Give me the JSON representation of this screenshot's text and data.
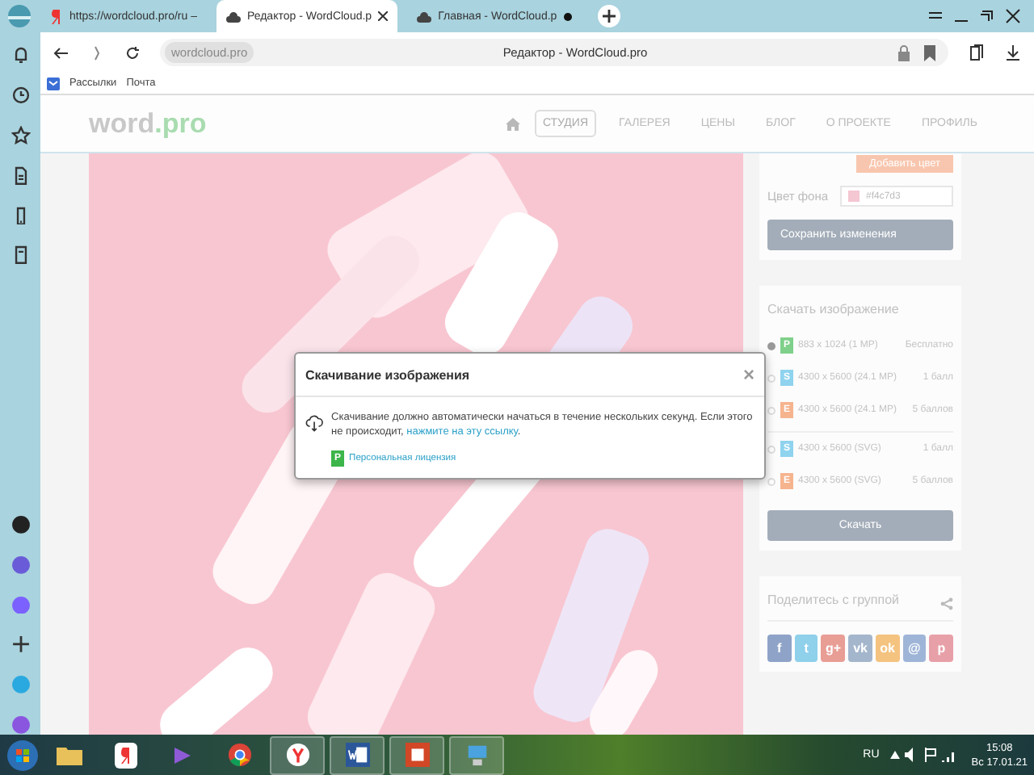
{
  "browser": {
    "tabs": [
      {
        "label": "https://wordcloud.pro/ru –",
        "kind": "yandex",
        "selected": false
      },
      {
        "label": "Редактор - WordCloud.p",
        "kind": "cloud",
        "selected": true
      },
      {
        "label": "Главная - WordCloud.p",
        "kind": "cloud",
        "selected": false
      }
    ],
    "address": "wordcloud.pro",
    "page_title": "Редактор - WordCloud.pro",
    "bookmarks": [
      "Рассылки",
      "Почта"
    ]
  },
  "site": {
    "logo_main": "word",
    "logo_accent": ".pro",
    "nav": [
      {
        "label": "СТУДИЯ",
        "selected": true
      },
      {
        "label": "ГАЛЕРЕЯ",
        "selected": false
      },
      {
        "label": "ЦЕНЫ",
        "selected": false
      },
      {
        "label": "БЛОГ",
        "selected": false
      },
      {
        "label": "О ПРОЕКТЕ",
        "selected": false
      },
      {
        "label": "ПРОФИЛЬ",
        "selected": false
      }
    ]
  },
  "panel": {
    "add_color_button": "Добавить цвет",
    "bg_color_label": "Цвет фона",
    "bg_color_value": "#f4c7d3",
    "save_button": "Сохранить изменения",
    "download_title": "Скачать изображение",
    "options": [
      {
        "badge": "P",
        "color": "#7fd08a",
        "size": "883 x 1024 (1 MP)",
        "price": "Бесплатно",
        "selected": true
      },
      {
        "badge": "S",
        "color": "#8fd3ef",
        "size": "4300 x 5600 (24.1 MP)",
        "price": "1 балл",
        "selected": false
      },
      {
        "badge": "E",
        "color": "#f6b48e",
        "size": "4300 x 5600 (24.1 MP)",
        "price": "5 баллов",
        "selected": false
      },
      {
        "badge": "S",
        "color": "#8fd3ef",
        "size": "4300 x 5600 (SVG)",
        "price": "1 балл",
        "selected": false
      },
      {
        "badge": "E",
        "color": "#f6b48e",
        "size": "4300 x 5600 (SVG)",
        "price": "5 баллов",
        "selected": false
      }
    ],
    "download_button": "Скачать",
    "share_title": "Поделитесь с группой",
    "socials": [
      {
        "label": "f",
        "color": "#8fa3c8"
      },
      {
        "label": "t",
        "color": "#8fd0ea"
      },
      {
        "label": "g+",
        "color": "#e89d95"
      },
      {
        "label": "vk",
        "color": "#a4b6cc"
      },
      {
        "label": "ok",
        "color": "#f4c37f"
      },
      {
        "label": "@",
        "color": "#9fb5d8"
      },
      {
        "label": "p",
        "color": "#e8a0a8"
      }
    ]
  },
  "dialog": {
    "title": "Скачивание изображения",
    "close": "×",
    "message": "Скачивание должно автоматически начаться в течение нескольких секунд. Если этого не происходит, ",
    "link": "нажмите на эту ссылку",
    "after": ".",
    "license_badge": "P",
    "license": "Персональная лицензия"
  },
  "taskbar": {
    "language": "RU",
    "time": "15:08",
    "date": "Вс 17.01.21"
  }
}
